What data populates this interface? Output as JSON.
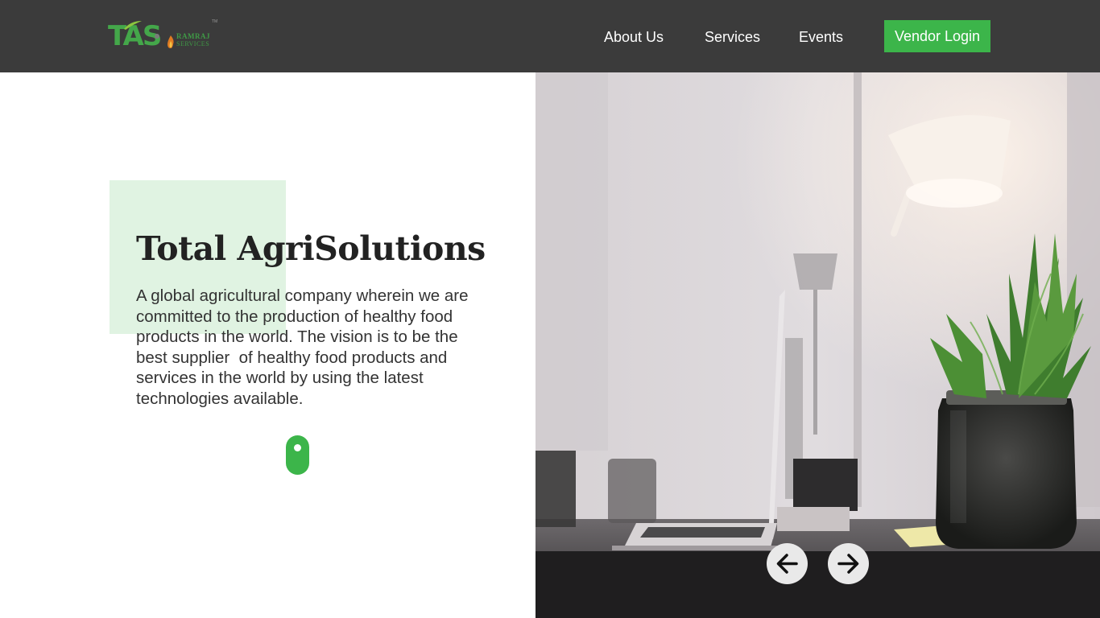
{
  "brand": {
    "logo_text": "TAS",
    "partner_line1": "RAMRAJ",
    "partner_line2": "SERVICES",
    "trademark": "TM",
    "accent_color": "#3cb54a"
  },
  "nav": {
    "items": [
      {
        "label": "About Us"
      },
      {
        "label": "Services"
      },
      {
        "label": "Events"
      }
    ],
    "vendor_login_label": "Vendor Login"
  },
  "hero": {
    "title": "Total AgriSolutions",
    "description": "A global agricultural company wherein we are committed to the production of healthy food products in the world. The vision is to be the best supplier  of healthy food products and services in the world by using the latest technologies available."
  },
  "carousel": {
    "prev_icon": "arrow-left-icon",
    "next_icon": "arrow-right-icon"
  },
  "colors": {
    "header_bg": "#3b3b3b",
    "accent_light": "#e0f3e2",
    "button_green": "#3cb54a"
  }
}
